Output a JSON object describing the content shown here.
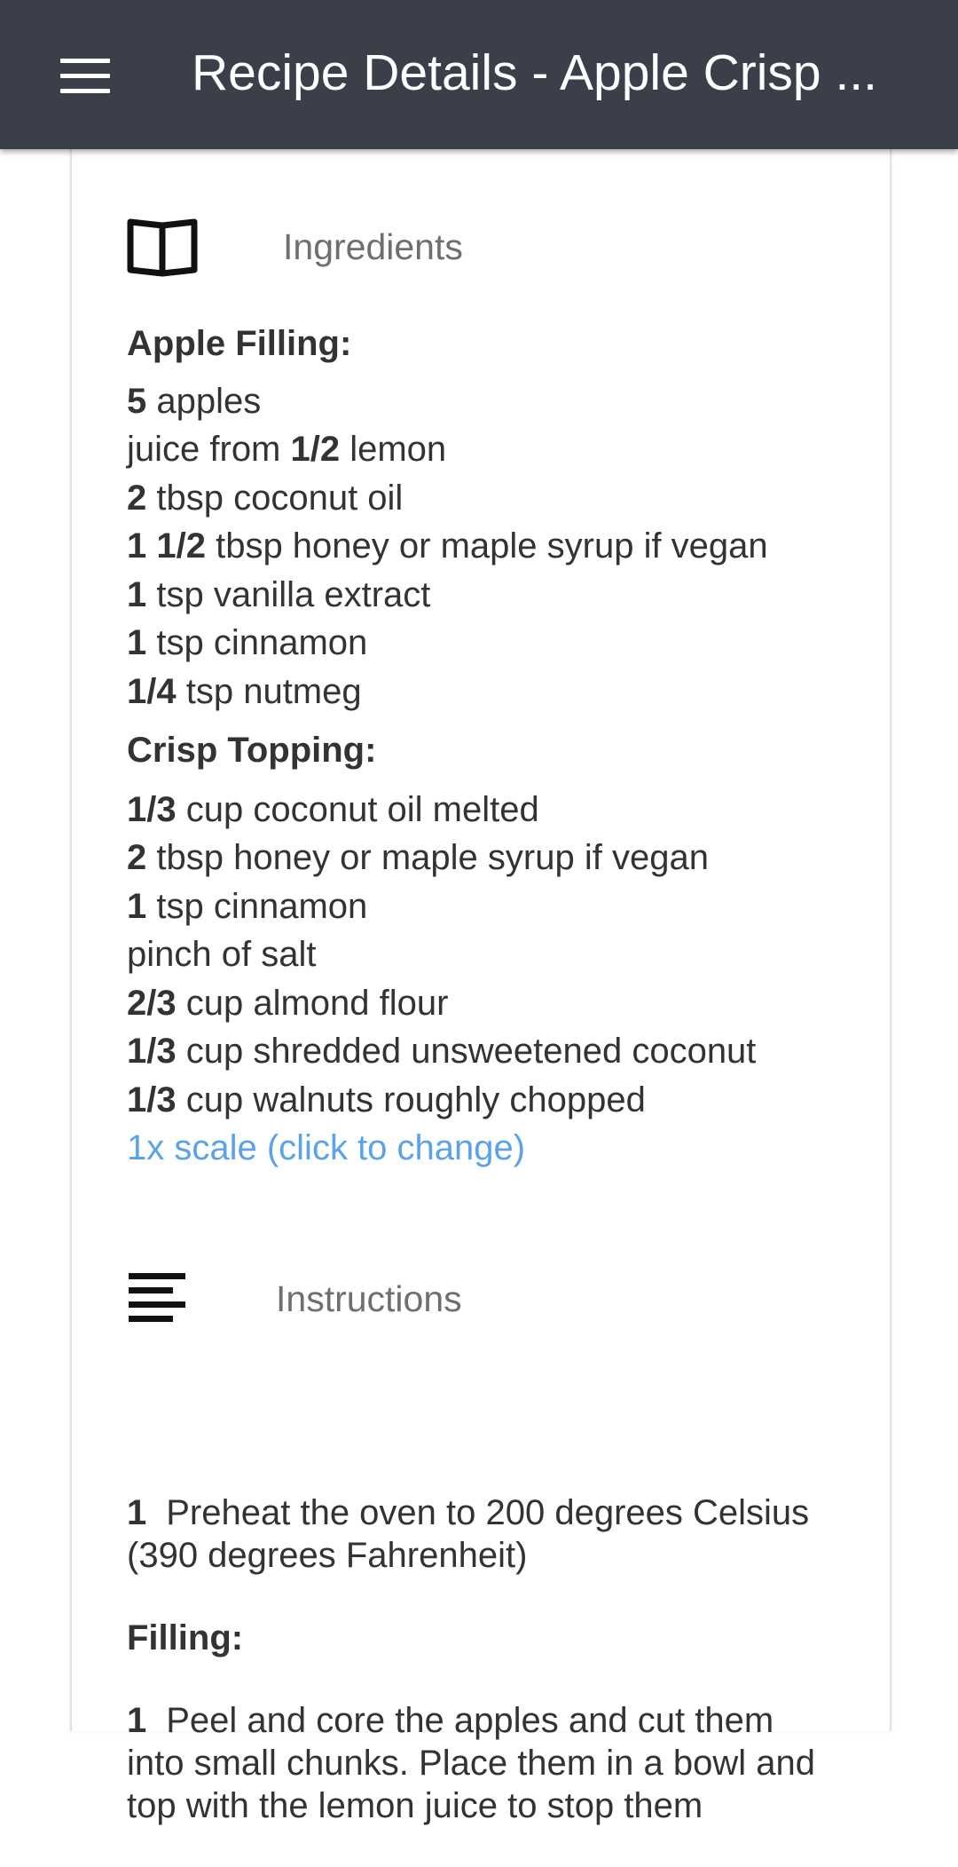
{
  "appbar": {
    "title": "Recipe Details - Apple Crisp ...",
    "menu_icon": "hamburger-menu-icon"
  },
  "ingredients_section": {
    "icon": "open-book-icon",
    "title": "Ingredients",
    "groups": [
      {
        "title": "Apple Filling:",
        "items": [
          {
            "qty": "5",
            "pre": "",
            "text": " apples"
          },
          {
            "qty": "1/2",
            "pre": "juice from ",
            "text": " lemon"
          },
          {
            "qty": "2",
            "pre": "",
            "text": " tbsp coconut oil"
          },
          {
            "qty": "1 1/2",
            "pre": "",
            "text": " tbsp honey or maple syrup if vegan"
          },
          {
            "qty": "1",
            "pre": "",
            "text": " tsp vanilla extract"
          },
          {
            "qty": "1",
            "pre": "",
            "text": " tsp cinnamon"
          },
          {
            "qty": "1/4",
            "pre": "",
            "text": " tsp nutmeg"
          }
        ]
      },
      {
        "title": "Crisp Topping:",
        "items": [
          {
            "qty": "1/3",
            "pre": "",
            "text": " cup coconut oil melted"
          },
          {
            "qty": "2",
            "pre": "",
            "text": " tbsp honey or maple syrup if vegan"
          },
          {
            "qty": "1",
            "pre": "",
            "text": " tsp cinnamon"
          },
          {
            "qty": "",
            "pre": "pinch of salt",
            "text": ""
          },
          {
            "qty": "2/3",
            "pre": "",
            "text": " cup almond flour"
          },
          {
            "qty": "1/3",
            "pre": "",
            "text": " cup shredded unsweetened coconut"
          },
          {
            "qty": "1/3",
            "pre": "",
            "text": " cup walnuts roughly chopped"
          }
        ]
      }
    ],
    "scale_link": "1x scale (click to change)"
  },
  "instructions_section": {
    "icon": "text-lines-icon",
    "title": "Instructions",
    "step1_num": "1",
    "step1_text": "Preheat the oven to 200 degrees Celsius (390 degrees Fahrenheit)",
    "filling_title": "Filling:",
    "step2_num": "1",
    "step2_text": "Peel and core the apples and cut them into small chunks. Place them in a bowl and top with the lemon juice to stop them"
  },
  "colors": {
    "appbar": "#3b3f4a",
    "link": "#5aa3e8",
    "section_title": "#6f6f6f",
    "text": "#333333"
  }
}
